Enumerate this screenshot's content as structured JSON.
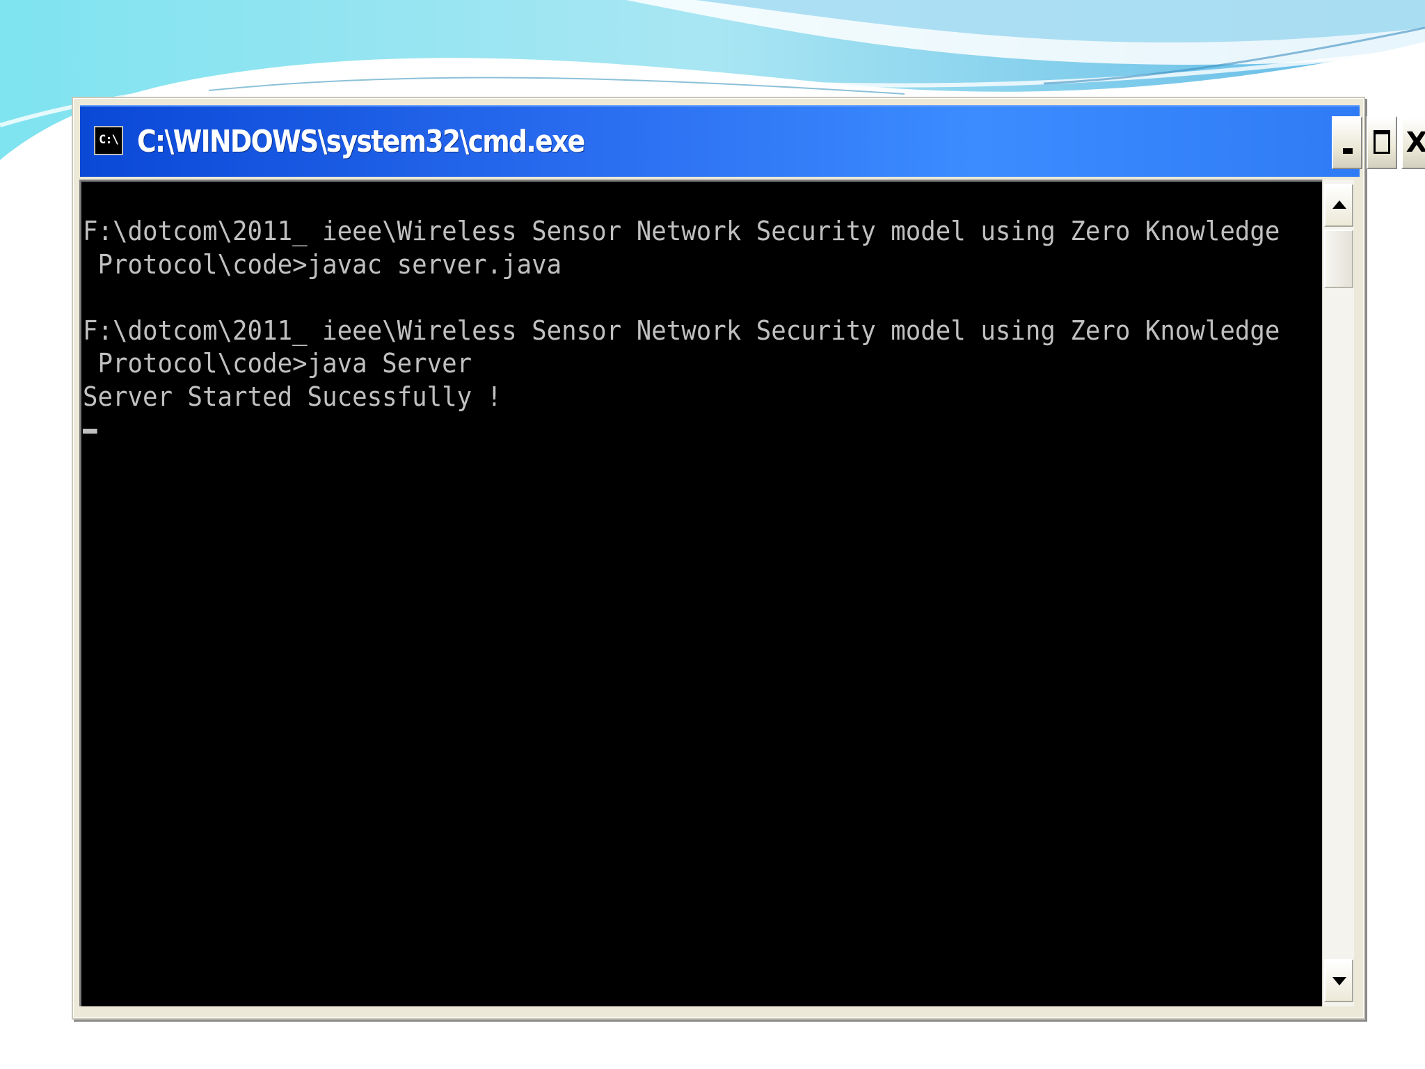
{
  "window": {
    "title": "C:\\WINDOWS\\system32\\cmd.exe",
    "icon": "cmd-icon",
    "icon_text": "C:\\",
    "buttons": {
      "minimize": "minimize-icon",
      "maximize": "maximize-icon",
      "close": "close-icon",
      "close_glyph": "X"
    }
  },
  "console": {
    "background_color": "#000000",
    "text_color": "#c0c0c0",
    "lines": [
      "F:\\dotcom\\2011_ ieee\\Wireless Sensor Network Security model using Zero Knowledge",
      " Protocol\\code>javac server.java",
      "",
      "F:\\dotcom\\2011_ ieee\\Wireless Sensor Network Security model using Zero Knowledge",
      " Protocol\\code>java Server",
      "Server Started Sucessfully !",
      ""
    ]
  },
  "scrollbar": {
    "up": "scroll-up-arrow-icon",
    "down": "scroll-down-arrow-icon"
  },
  "colors": {
    "titlebar_start": "#0a48d6",
    "titlebar_end": "#3c8cff",
    "frame": "#ece9d8"
  }
}
